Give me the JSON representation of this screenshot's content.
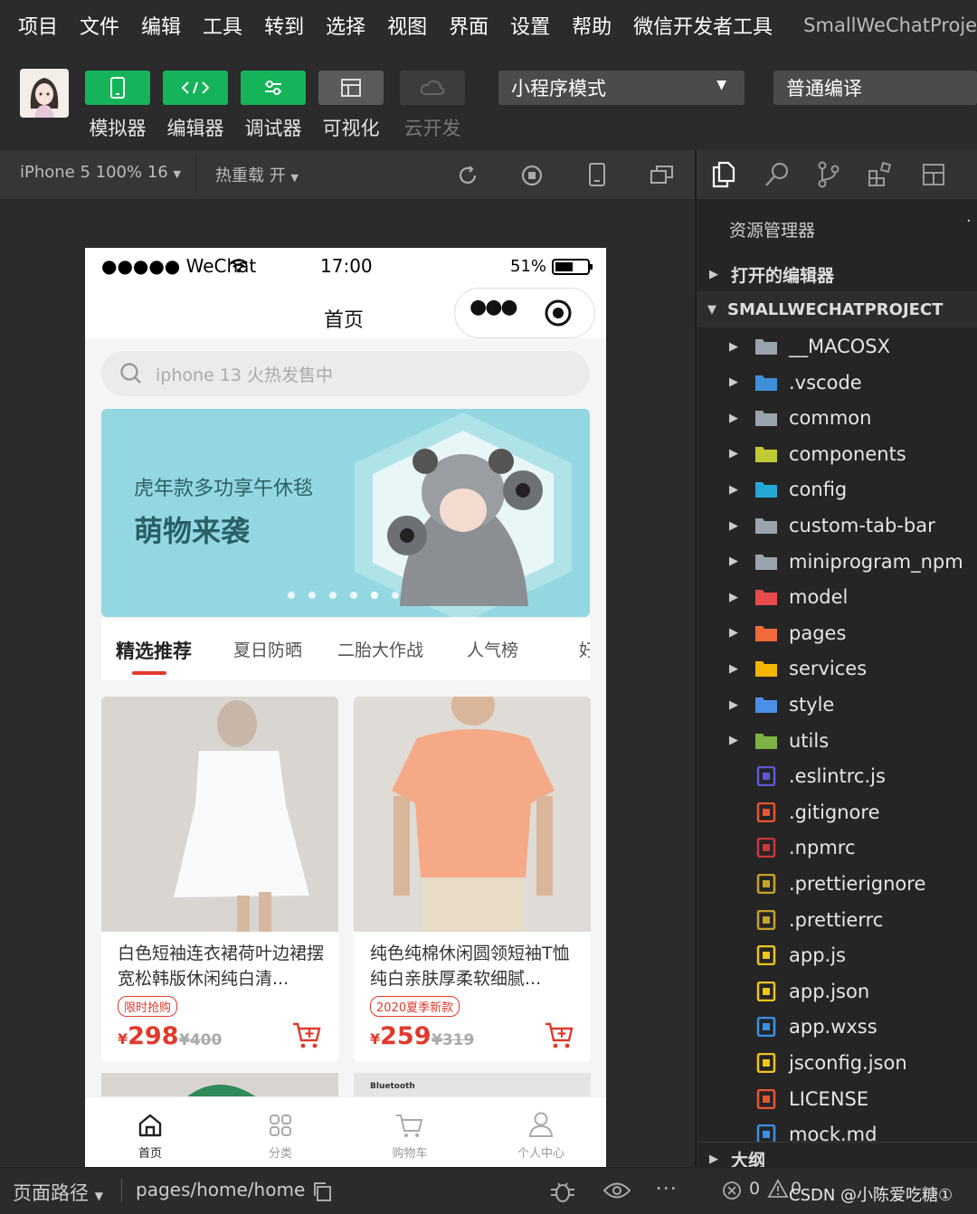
{
  "menubar": {
    "items": [
      "项目",
      "文件",
      "编辑",
      "工具",
      "转到",
      "选择",
      "视图",
      "界面",
      "设置",
      "帮助",
      "微信开发者工具"
    ],
    "project": "SmallWeChatProject"
  },
  "toolbar": {
    "buttons": [
      {
        "label": "模拟器"
      },
      {
        "label": "编辑器"
      },
      {
        "label": "调试器"
      },
      {
        "label": "可视化"
      },
      {
        "label": "云开发"
      }
    ],
    "mode": "小程序模式",
    "compile": "普通编译"
  },
  "simbar": {
    "device": "iPhone 5 100% 16",
    "hotreload": "热重载 开"
  },
  "phone": {
    "status_left": "●●●●● WeChat",
    "time": "17:00",
    "battery": "51%",
    "nav_title": "首页",
    "search_placeholder": "iphone 13 火热发售中",
    "banner_sub": "虎年款多功享午休毯",
    "banner_title": "萌物来袭",
    "tabs": [
      "精选推荐",
      "夏日防晒",
      "二胎大作战",
      "人气榜",
      "好"
    ],
    "products": [
      {
        "title": "白色短袖连衣裙荷叶边裙摆宽松韩版休闲纯白清...",
        "tag": "限时抢购",
        "currency": "¥",
        "price": "298",
        "old": "¥400"
      },
      {
        "title": "纯色纯棉休闲圆领短袖T恤纯白亲肤厚柔软细腻...",
        "tag": "2020夏季新款",
        "currency": "¥",
        "price": "259",
        "old": "¥319"
      }
    ],
    "partial_label": "Bluetooth",
    "tabbar": [
      "首页",
      "分类",
      "购物车",
      "个人中心"
    ]
  },
  "explorer": {
    "title": "资源管理器",
    "open_editors": "打开的编辑器",
    "project": "SMALLWECHATPROJECT",
    "items": [
      {
        "name": "__MACOSX",
        "icon": "folder-icon",
        "folder": true,
        "color": "#9aa4ad"
      },
      {
        "name": ".vscode",
        "icon": "vscode-folder-icon",
        "folder": true,
        "color": "#3f8fd8"
      },
      {
        "name": "common",
        "icon": "folder-icon",
        "folder": true,
        "color": "#9aa4ad"
      },
      {
        "name": "components",
        "icon": "components-folder-icon",
        "folder": true,
        "color": "#c0ca33"
      },
      {
        "name": "config",
        "icon": "config-folder-icon",
        "folder": true,
        "color": "#26a8d6"
      },
      {
        "name": "custom-tab-bar",
        "icon": "folder-icon",
        "folder": true,
        "color": "#9aa4ad"
      },
      {
        "name": "miniprogram_npm",
        "icon": "folder-icon",
        "folder": true,
        "color": "#9aa4ad"
      },
      {
        "name": "model",
        "icon": "model-folder-icon",
        "folder": true,
        "color": "#e84b4b"
      },
      {
        "name": "pages",
        "icon": "pages-folder-icon",
        "folder": true,
        "color": "#ef6b3a"
      },
      {
        "name": "services",
        "icon": "services-folder-icon",
        "folder": true,
        "color": "#f4b400"
      },
      {
        "name": "style",
        "icon": "style-folder-icon",
        "folder": true,
        "color": "#4b8fe8"
      },
      {
        "name": "utils",
        "icon": "utils-folder-icon",
        "folder": true,
        "color": "#7cb342"
      },
      {
        "name": ".eslintrc.js",
        "icon": "eslint-icon",
        "folder": false,
        "color": "#5b5bd6"
      },
      {
        "name": ".gitignore",
        "icon": "git-icon",
        "folder": false,
        "color": "#e8552f"
      },
      {
        "name": ".npmrc",
        "icon": "npm-icon",
        "folder": false,
        "color": "#cb3837"
      },
      {
        "name": ".prettierignore",
        "icon": "prettier-icon",
        "folder": false,
        "color": "#c9a227"
      },
      {
        "name": ".prettierrc",
        "icon": "prettier-icon",
        "folder": false,
        "color": "#c9a227"
      },
      {
        "name": "app.js",
        "icon": "js-icon",
        "folder": false,
        "color": "#f0c419"
      },
      {
        "name": "app.json",
        "icon": "json-icon",
        "folder": false,
        "color": "#f0c419"
      },
      {
        "name": "app.wxss",
        "icon": "css-icon",
        "folder": false,
        "color": "#3b8fe8"
      },
      {
        "name": "jsconfig.json",
        "icon": "json-icon",
        "folder": false,
        "color": "#f0c419"
      },
      {
        "name": "LICENSE",
        "icon": "license-icon",
        "folder": false,
        "color": "#e8552f"
      },
      {
        "name": "mock.md",
        "icon": "markdown-icon",
        "folder": false,
        "color": "#3b8fe8"
      }
    ],
    "outline": "大纲"
  },
  "statusbar": {
    "path_label": "页面路径",
    "path": "pages/home/home",
    "errors": "0",
    "warnings": "0",
    "watermark": "CSDN @小陈爱吃糖①"
  },
  "colors": {
    "accent_green": "#16b45a",
    "price_red": "#e03a2b",
    "banner_teal": "#8fd6de"
  }
}
